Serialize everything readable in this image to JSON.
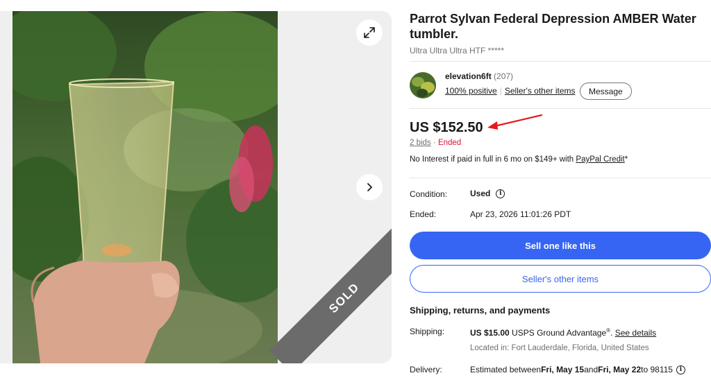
{
  "gallery": {
    "sold_label": "SOLD",
    "expand_icon": "expand-icon",
    "next_icon": "chevron-right-icon"
  },
  "item": {
    "title": "Parrot Sylvan Federal Depression AMBER Water tumbler.",
    "subtitle": "Ultra Ultra Ultra HTF *****"
  },
  "seller": {
    "name": "elevation6ft",
    "feedback_count": "(207)",
    "positive": "100% positive",
    "other_items": "Seller's other items",
    "message_label": "Message"
  },
  "pricing": {
    "price": "US $152.50",
    "bids": "2 bids",
    "dot": "·",
    "status": "Ended",
    "credit_prefix": "No Interest if paid in full in 6 mo on $149+ with ",
    "credit_link": "PayPal Credit",
    "credit_suffix": "*"
  },
  "specs": {
    "condition_label": "Condition:",
    "condition_value": "Used",
    "ended_label": "Ended:",
    "ended_value": "Apr 23, 2026 11:01:26 PDT"
  },
  "actions": {
    "sell_like_this": "Sell one like this",
    "seller_other_items": "Seller's other items"
  },
  "shipping": {
    "heading": "Shipping, returns, and payments",
    "shipping_label": "Shipping:",
    "shipping_price": "US $15.00",
    "shipping_service": " USPS Ground Advantage",
    "shipping_reg": "®",
    "shipping_details": "See details",
    "located": "Located in: Fort Lauderdale, Florida, United States",
    "delivery_label": "Delivery:",
    "delivery_prefix": "Estimated between ",
    "delivery_from": "Fri, May 15",
    "delivery_and": " and ",
    "delivery_to": "Fri, May 22",
    "delivery_zip": " to 98115"
  },
  "colors": {
    "brand_blue": "#3665f3",
    "ended_red": "#e0103a",
    "arrow_red": "#e8191e"
  }
}
